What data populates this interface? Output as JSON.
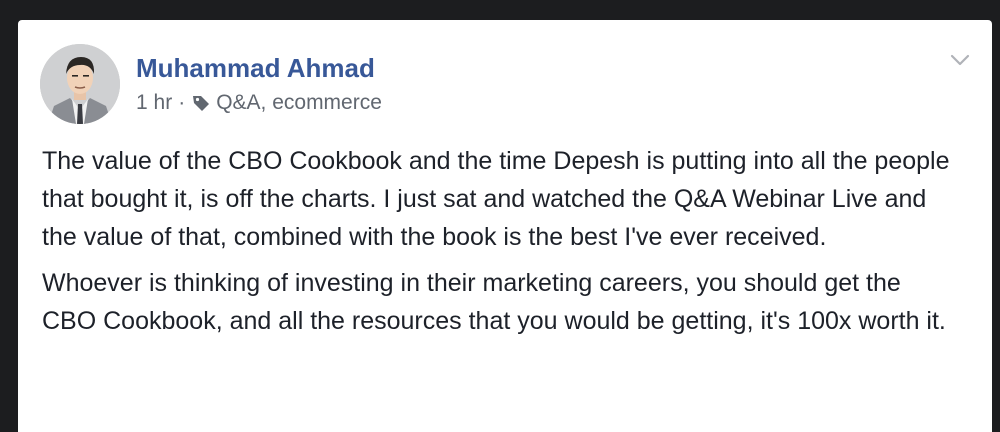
{
  "post": {
    "author": "Muhammad Ahmad",
    "time": "1 hr",
    "separator": "·",
    "tags": "Q&A, ecommerce",
    "paragraphs": [
      "The value of the CBO Cookbook and the time Depesh is putting into all the people that bought it, is off the charts. I just sat and watched the Q&A Webinar Live and the value of that, combined with the book is the best I've ever received.",
      "Whoever is thinking of investing in their marketing careers, you should get the CBO Cookbook, and all the resources that you would be getting, it's 100x worth it."
    ]
  },
  "icons": {
    "avatar": "avatar",
    "tag": "tag-icon",
    "menu": "chevron-down-icon"
  },
  "colors": {
    "author_link": "#385898",
    "meta_text": "#616770",
    "body_text": "#1d2129",
    "background": "#1c1d1f",
    "card": "#ffffff"
  }
}
